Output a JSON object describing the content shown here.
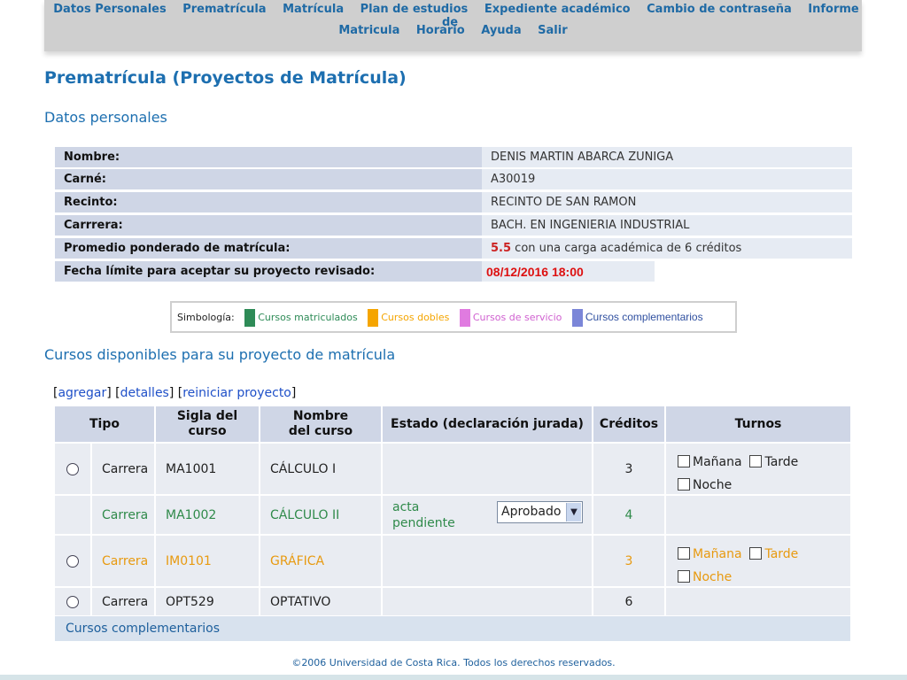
{
  "nav": {
    "row1": [
      "Datos Personales",
      "Prematrícula",
      "Matrícula",
      "Plan de estudios",
      "Expediente académico",
      "Cambio de contraseña",
      "Informe de"
    ],
    "row2": [
      "Matricula",
      "Horario",
      "Ayuda",
      "Salir"
    ]
  },
  "page_title": "Prematrícula (Proyectos de Matrícula)",
  "personal": {
    "heading": "Datos personales",
    "rows": [
      {
        "label": "Nombre:",
        "value": "DENIS MARTIN ABARCA ZUNIGA"
      },
      {
        "label": "Carné:",
        "value": "A30019"
      },
      {
        "label": "Recinto:",
        "value": "RECINTO DE SAN RAMON"
      },
      {
        "label": "Carrrera:",
        "value": "BACH. EN INGENIERIA INDUSTRIAL"
      }
    ],
    "promedio": {
      "label": "Promedio ponderado de matrícula:",
      "value": "5.5",
      "suffix": "con una carga académica de 6 créditos"
    },
    "fecha": {
      "label": "Fecha límite para aceptar su proyecto revisado:",
      "value": "08/12/2016 18:00"
    }
  },
  "legend": {
    "title": "Simbología:",
    "items": [
      {
        "label": "Cursos matriculados",
        "color": "#2e8b57"
      },
      {
        "label": "Cursos dobles",
        "color": "#f5a500"
      },
      {
        "label": "Cursos de servicio",
        "color": "#e07be0"
      },
      {
        "label": "Cursos complementarios",
        "color": "#7b86d8"
      }
    ]
  },
  "cursos_heading": "Cursos disponibles para su proyecto de matrícula",
  "links": {
    "agregar": "agregar",
    "detalles": "detalles",
    "reiniciar": "reiniciar proyecto"
  },
  "table": {
    "headers": [
      "Tipo",
      "Sigla del curso",
      "Nombre del curso",
      "Estado (declaración jurada)",
      "Créditos",
      "Turnos"
    ],
    "rows": [
      {
        "tipo": "Carrera",
        "sigla": "MA1001",
        "nombre": "CÁLCULO I",
        "estado": "",
        "creditos": "3",
        "turnos": [
          "Mañana",
          "Tarde",
          "Noche"
        ]
      },
      {
        "tipo": "Carrera",
        "sigla": "MA1002",
        "nombre": "CÁLCULO II",
        "estado": "acta pendiente",
        "select": "Aprobado",
        "creditos": "4"
      },
      {
        "tipo": "Carrera",
        "sigla": "IM0101",
        "nombre": "GRÁFICA",
        "estado": "",
        "creditos": "3",
        "turnos": [
          "Mañana",
          "Tarde",
          "Noche"
        ]
      },
      {
        "tipo": "Carrera",
        "sigla": "OPT529",
        "nombre": "OPTATIVO",
        "estado": "",
        "creditos": "6"
      }
    ],
    "complementarios": "Cursos complementarios"
  },
  "footer": "©2006 Universidad de Costa Rica. Todos los derechos reservados."
}
